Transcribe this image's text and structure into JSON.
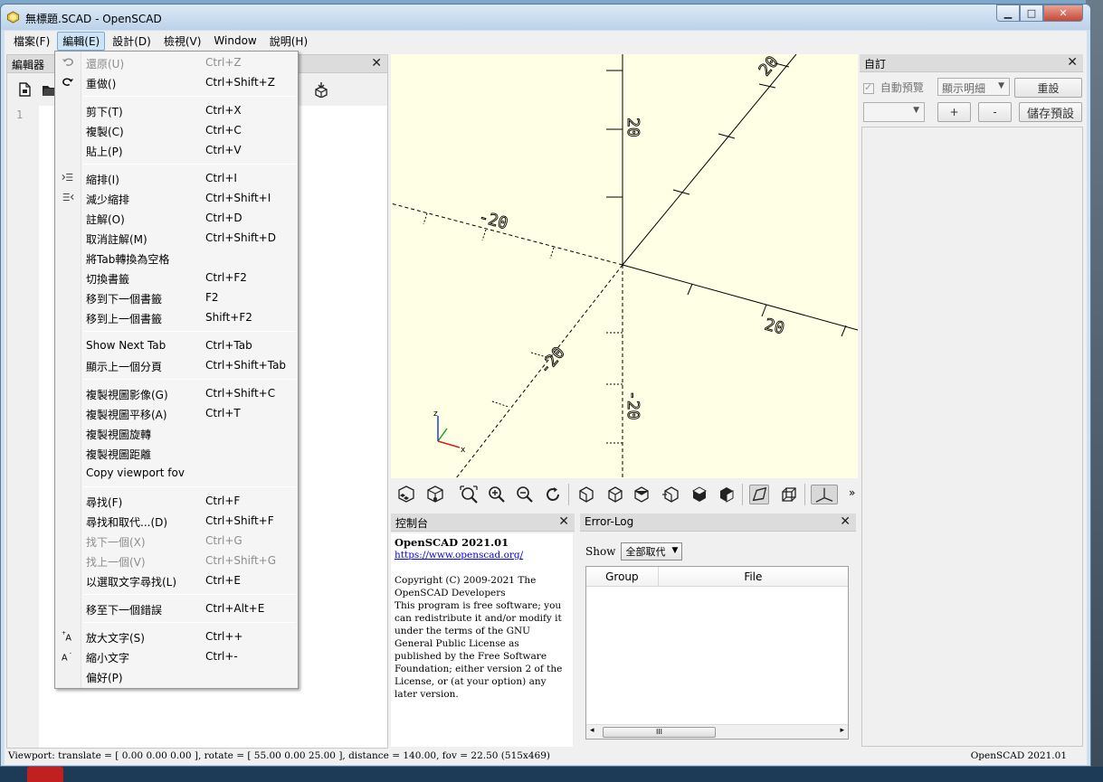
{
  "window": {
    "title": "無標題.SCAD - OpenSCAD",
    "controls": {
      "minimize": "▁",
      "maximize": "□",
      "close": "✕"
    }
  },
  "menubar": [
    "檔案(F)",
    "編輯(E)",
    "設計(D)",
    "檢視(V)",
    "Window",
    "說明(H)"
  ],
  "editor": {
    "title": "編輯器",
    "line_numbers": [
      "1"
    ]
  },
  "edit_menu": {
    "groups": [
      [
        {
          "label": "還原(U)",
          "shortcut": "Ctrl+Z",
          "icon": "undo-icon",
          "disabled": true
        },
        {
          "label": "重做()",
          "shortcut": "Ctrl+Shift+Z",
          "icon": "redo-icon",
          "disabled": false
        }
      ],
      [
        {
          "label": "剪下(T)",
          "shortcut": "Ctrl+X",
          "icon": "",
          "disabled": false
        },
        {
          "label": "複製(C)",
          "shortcut": "Ctrl+C",
          "icon": "",
          "disabled": false
        },
        {
          "label": "貼上(P)",
          "shortcut": "Ctrl+V",
          "icon": "",
          "disabled": false
        }
      ],
      [
        {
          "label": "縮排(I)",
          "shortcut": "Ctrl+I",
          "icon": "indent-icon",
          "disabled": false
        },
        {
          "label": "減少縮排",
          "shortcut": "Ctrl+Shift+I",
          "icon": "unindent-icon",
          "disabled": false
        },
        {
          "label": "註解(O)",
          "shortcut": "Ctrl+D",
          "icon": "",
          "disabled": false
        },
        {
          "label": "取消註解(M)",
          "shortcut": "Ctrl+Shift+D",
          "icon": "",
          "disabled": false
        },
        {
          "label": "將Tab轉換為空格",
          "shortcut": "",
          "icon": "",
          "disabled": false
        },
        {
          "label": "切換書籤",
          "shortcut": "Ctrl+F2",
          "icon": "",
          "disabled": false
        },
        {
          "label": "移到下一個書籤",
          "shortcut": "F2",
          "icon": "",
          "disabled": false
        },
        {
          "label": "移到上一個書籤",
          "shortcut": "Shift+F2",
          "icon": "",
          "disabled": false
        }
      ],
      [
        {
          "label": "Show Next Tab",
          "shortcut": "Ctrl+Tab",
          "icon": "",
          "disabled": false
        },
        {
          "label": "顯示上一個分頁",
          "shortcut": "Ctrl+Shift+Tab",
          "icon": "",
          "disabled": false
        }
      ],
      [
        {
          "label": "複製視圖影像(G)",
          "shortcut": "Ctrl+Shift+C",
          "icon": "",
          "disabled": false
        },
        {
          "label": "複製視圖平移(A)",
          "shortcut": "Ctrl+T",
          "icon": "",
          "disabled": false
        },
        {
          "label": "複製視圖旋轉",
          "shortcut": "",
          "icon": "",
          "disabled": false
        },
        {
          "label": "複製視圖距離",
          "shortcut": "",
          "icon": "",
          "disabled": false
        },
        {
          "label": "Copy viewport fov",
          "shortcut": "",
          "icon": "",
          "disabled": false
        }
      ],
      [
        {
          "label": "尋找(F)",
          "shortcut": "Ctrl+F",
          "icon": "",
          "disabled": false
        },
        {
          "label": "尋找和取代...(D)",
          "shortcut": "Ctrl+Shift+F",
          "icon": "",
          "disabled": false
        },
        {
          "label": "找下一個(X)",
          "shortcut": "Ctrl+G",
          "icon": "",
          "disabled": true
        },
        {
          "label": "找上一個(V)",
          "shortcut": "Ctrl+Shift+G",
          "icon": "",
          "disabled": true
        },
        {
          "label": "以選取文字尋找(L)",
          "shortcut": "Ctrl+E",
          "icon": "",
          "disabled": false
        }
      ],
      [
        {
          "label": "移至下一個錯誤",
          "shortcut": "Ctrl+Alt+E",
          "icon": "",
          "disabled": false
        }
      ],
      [
        {
          "label": "放大文字(S)",
          "shortcut": "Ctrl++",
          "icon": "zoom-in-text-icon",
          "disabled": false
        },
        {
          "label": "縮小文字",
          "shortcut": "Ctrl+-",
          "icon": "zoom-out-text-icon",
          "disabled": false
        },
        {
          "label": "偏好(P)",
          "shortcut": "",
          "icon": "",
          "disabled": false
        }
      ]
    ]
  },
  "viewport": {
    "axis_labels": [
      "20",
      "-20",
      "20",
      "-20",
      "20",
      "-20"
    ],
    "gizmo": {
      "z": "z",
      "x": "x"
    }
  },
  "view_toolbar": {
    "overflow": "»"
  },
  "console": {
    "title": "控制台",
    "heading": "OpenSCAD 2021.01",
    "link": "https://www.openscad.org/",
    "copyright": "Copyright (C) 2009-2021 The OpenSCAD Developers",
    "license": "This program is free software; you can redistribute it and/or modify it under the terms of the GNU General Public License as published by the Free Software Foundation; either version 2 of the License, or (at your option) any later version."
  },
  "error_log": {
    "title": "Error-Log",
    "show_label": "Show",
    "show_value": "全部取代",
    "columns": [
      "Group",
      "File"
    ],
    "scroll_thumb": "III"
  },
  "customizer": {
    "title": "自訂",
    "auto_preview": "自動預覽",
    "detail_select": "顯示明細",
    "reset": "重設",
    "preset_select": "",
    "plus": "+",
    "minus": "-",
    "save_preset": "儲存預設"
  },
  "statusbar": {
    "viewport": "Viewport: translate = [ 0.00 0.00 0.00 ], rotate = [ 55.00 0.00 25.00 ], distance = 140.00, fov = 22.50 (515x469)",
    "version": "OpenSCAD 2021.01"
  },
  "colors": {
    "viewport_bg": "#ffffe5",
    "axis": "#000000",
    "gizmo_x": "#d02020",
    "gizmo_y": "#20a020",
    "gizmo_z": "#2040d0"
  }
}
